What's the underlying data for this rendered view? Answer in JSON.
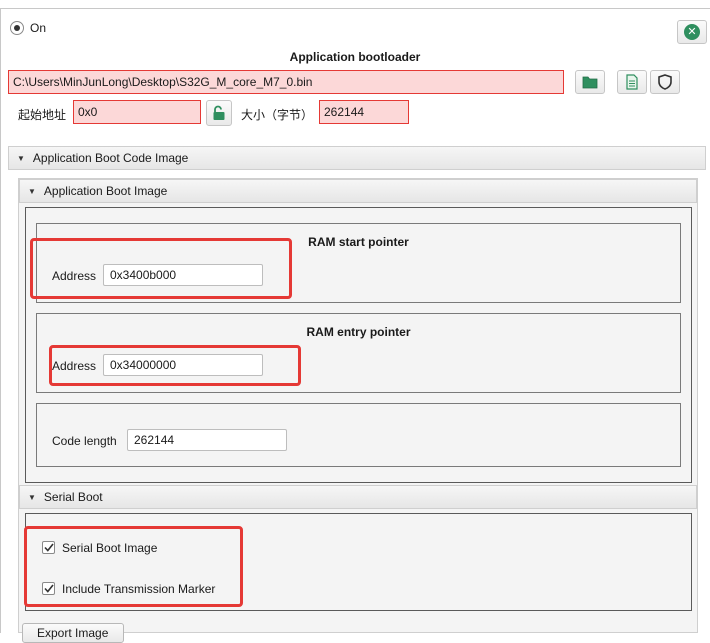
{
  "header": {
    "radio_label": "On",
    "title": "Application bootloader",
    "file_path": "C:\\Users\\MinJunLong\\Desktop\\S32G_M_core_M7_0.bin",
    "start_addr_label": "起始地址",
    "start_addr_value": "0x0",
    "size_label": "大小（字节）",
    "size_value": "262144"
  },
  "sections": {
    "boot_code": {
      "label": "Application Boot Code Image"
    },
    "boot_image": {
      "label": "Application Boot Image"
    },
    "serial_boot": {
      "label": "Serial Boot"
    }
  },
  "ram_start": {
    "title": "RAM start pointer",
    "address_label": "Address",
    "address_value": "0x3400b000"
  },
  "ram_entry": {
    "title": "RAM entry pointer",
    "address_label": "Address",
    "address_value": "0x34000000"
  },
  "code_length": {
    "label": "Code length",
    "value": "262144"
  },
  "serial": {
    "serial_boot_image": {
      "label": "Serial Boot Image",
      "checked": true
    },
    "include_marker": {
      "label": "Include Transmission Marker",
      "checked": true
    }
  },
  "footer": {
    "button_label": "Export Image"
  },
  "colors": {
    "error_bg": "#fcd8d8",
    "error_border": "#e53935",
    "accent_green": "#2f8f5f",
    "highlight_red": "#e53935"
  },
  "icons": [
    "radio-selected-icon",
    "close-circle-icon",
    "folder-icon",
    "document-icon",
    "shield-icon",
    "unlock-icon",
    "triangle-down-icon",
    "checkmark-icon"
  ]
}
